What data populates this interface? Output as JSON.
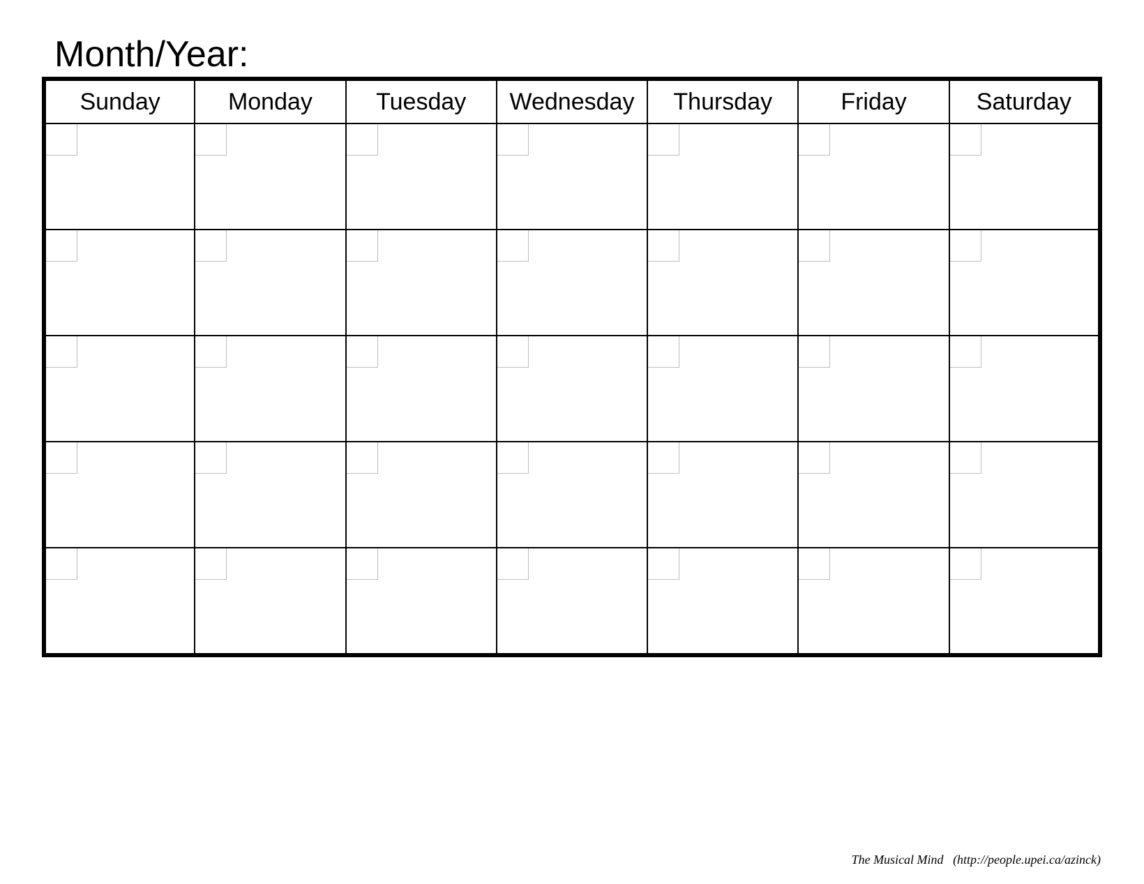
{
  "title": "Month/Year:",
  "days": [
    "Sunday",
    "Monday",
    "Tuesday",
    "Wednesday",
    "Thursday",
    "Friday",
    "Saturday"
  ],
  "weeks": 5,
  "footer_source": "The Musical Mind",
  "footer_url": "(http://people.upei.ca/azinck)"
}
